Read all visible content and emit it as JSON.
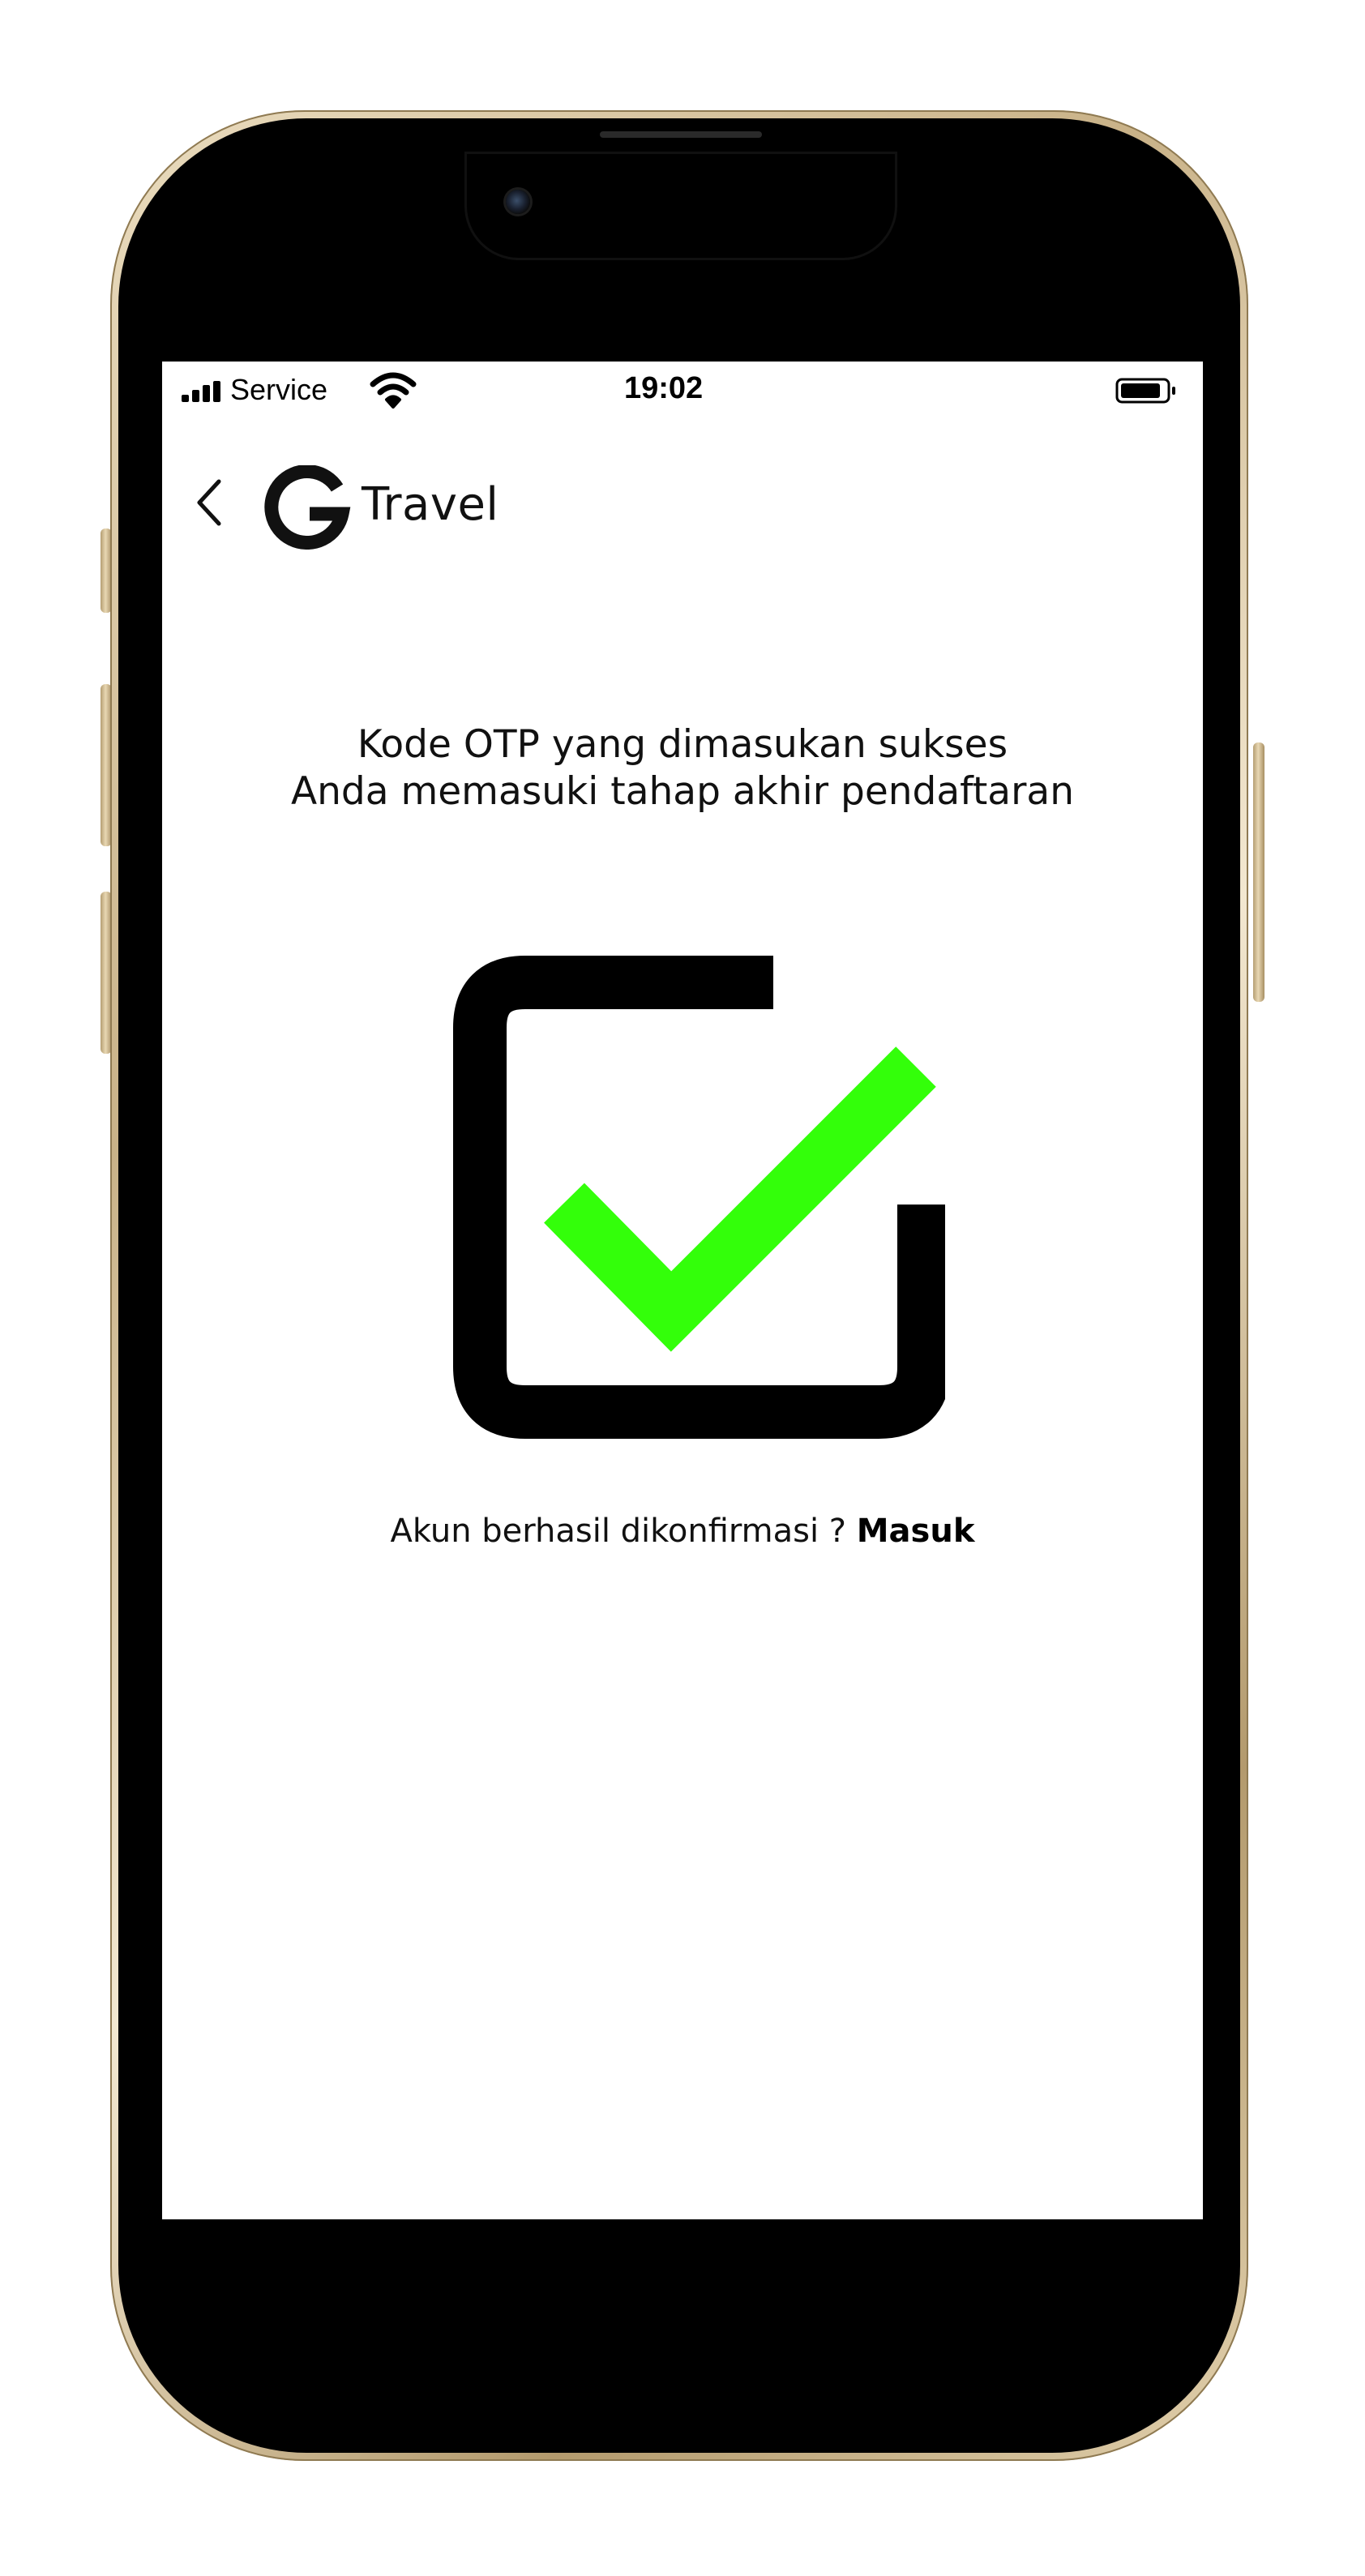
{
  "status_bar": {
    "carrier": "Service",
    "time": "19:02",
    "icons": [
      "signal-icon",
      "wifi-icon",
      "battery-icon"
    ]
  },
  "header": {
    "back_icon": "chevron-left-icon",
    "logo_letter": "G",
    "brand_name": "Travel"
  },
  "main": {
    "message_line1": "Kode OTP yang dimasukan sukses",
    "message_line2": "Anda memasuki tahap akhir pendaftaran",
    "success_icon": "checkbox-checked-icon",
    "confirm_text": "Akun berhasil dikonfirmasi ? ",
    "login_link": "Masuk"
  },
  "colors": {
    "check": "#33ff0a",
    "frame_gold": "#d9c6a0",
    "text": "#111111",
    "background": "#ffffff"
  }
}
